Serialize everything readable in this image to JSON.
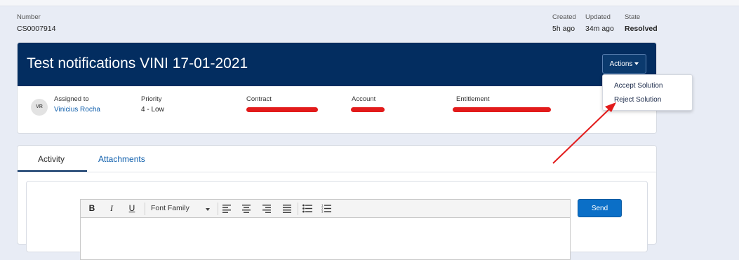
{
  "record": {
    "number_label": "Number",
    "number_value": "CS0007914",
    "created_label": "Created",
    "created_value": "5h ago",
    "updated_label": "Updated",
    "updated_value": "34m ago",
    "state_label": "State",
    "state_value": "Resolved"
  },
  "case": {
    "title": "Test notifications VINI 17-01-2021",
    "actions_label": "Actions"
  },
  "details": {
    "avatar_initials": "VR",
    "assigned_label": "Assigned to",
    "assigned_value": "Vinicius Rocha",
    "priority_label": "Priority",
    "priority_value": "4 - Low",
    "contract_label": "Contract",
    "account_label": "Account",
    "entitlement_label": "Entitlement"
  },
  "actions_menu": {
    "items": [
      "Accept Solution",
      "Reject Solution"
    ]
  },
  "tabs": {
    "items": [
      "Activity",
      "Attachments"
    ],
    "active": "Activity"
  },
  "composer": {
    "font_family_label": "Font Family",
    "send_label": "Send"
  },
  "colors": {
    "header": "#032d60",
    "send": "#0b6fc7",
    "redaction": "#e21b1b",
    "annotation_arrow": "#e21b1b"
  }
}
